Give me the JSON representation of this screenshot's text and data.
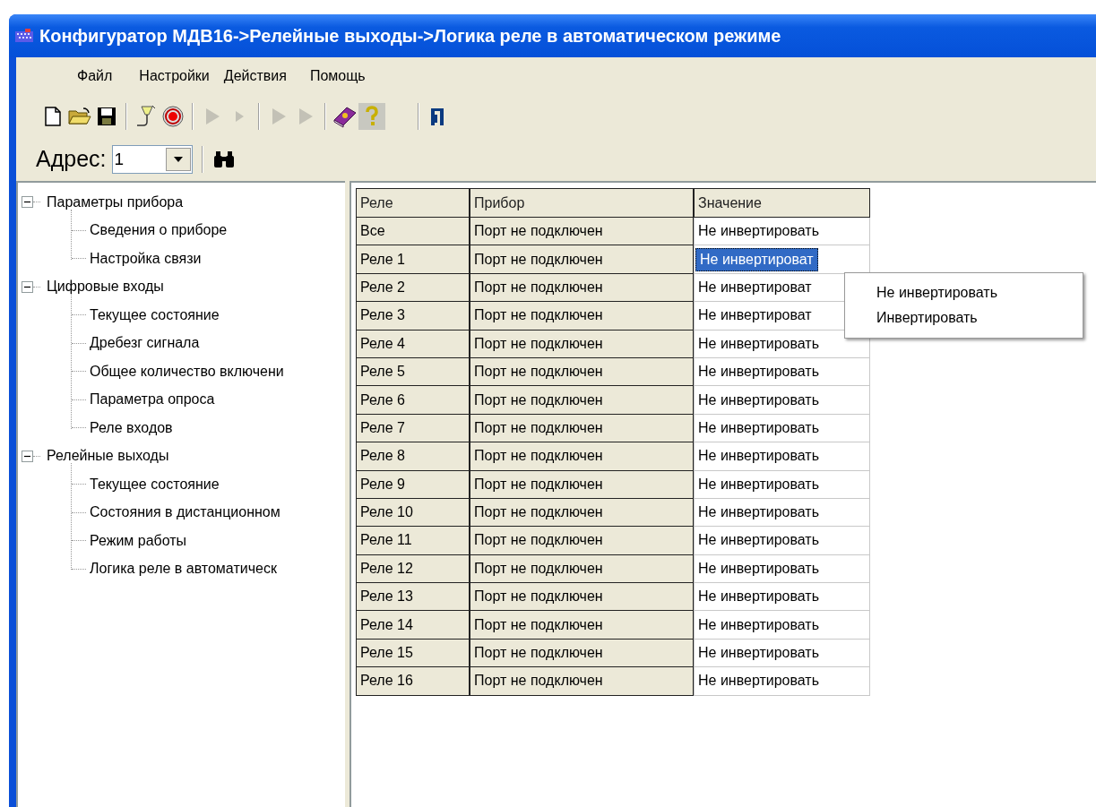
{
  "window": {
    "title": "Конфигуратор МДВ16->Релейные выходы->Логика реле в автоматическом режиме"
  },
  "menu": [
    "Файл",
    "Настройки",
    "Действия",
    "Помощь"
  ],
  "toolbar": [
    {
      "kind": "new",
      "disabled": false
    },
    {
      "kind": "open",
      "disabled": false
    },
    {
      "kind": "save",
      "disabled": false
    },
    {
      "kind": "separator"
    },
    {
      "kind": "probe",
      "disabled": false
    },
    {
      "kind": "record",
      "disabled": false
    },
    {
      "kind": "separator"
    },
    {
      "kind": "play",
      "disabled": true
    },
    {
      "kind": "play-small",
      "disabled": true
    },
    {
      "kind": "separator"
    },
    {
      "kind": "play",
      "disabled": true
    },
    {
      "kind": "play",
      "disabled": true
    },
    {
      "kind": "separator"
    },
    {
      "kind": "book",
      "disabled": false
    },
    {
      "kind": "help",
      "disabled": false
    },
    {
      "kind": "gap"
    },
    {
      "kind": "separator"
    },
    {
      "kind": "exit",
      "disabled": false
    }
  ],
  "address": {
    "label": "Адрес:",
    "value": "1"
  },
  "tree": [
    {
      "label": "Параметры прибора",
      "expanded": true,
      "children": [
        {
          "label": "Сведения о приборе"
        },
        {
          "label": "Настройка связи"
        }
      ]
    },
    {
      "label": "Цифровые входы",
      "expanded": true,
      "children": [
        {
          "label": "Текущее состояние"
        },
        {
          "label": "Дребезг сигнала"
        },
        {
          "label": "Общее количество включени"
        },
        {
          "label": "Параметра опроса"
        },
        {
          "label": "Реле входов"
        }
      ]
    },
    {
      "label": "Релейные выходы",
      "expanded": true,
      "children": [
        {
          "label": "Текущее состояние"
        },
        {
          "label": "Состояния в дистанционном"
        },
        {
          "label": "Режим работы"
        },
        {
          "label": "Логика реле в автоматическ"
        }
      ]
    }
  ],
  "table": {
    "columns": [
      "Реле",
      "Прибор",
      "Значение"
    ],
    "rows": [
      {
        "cells": [
          "Все",
          "Порт не подключен",
          "Не инвертировать"
        ],
        "selected": false
      },
      {
        "cells": [
          "Реле 1",
          "Порт не подключен",
          "Не инвертироват"
        ],
        "selected": true
      },
      {
        "cells": [
          "Реле 2",
          "Порт не подключен",
          "Не инвертироват"
        ],
        "selected": false
      },
      {
        "cells": [
          "Реле 3",
          "Порт не подключен",
          "Не инвертироват"
        ],
        "selected": false
      },
      {
        "cells": [
          "Реле 4",
          "Порт не подключен",
          "Не инвертировать"
        ],
        "selected": false
      },
      {
        "cells": [
          "Реле 5",
          "Порт не подключен",
          "Не инвертировать"
        ],
        "selected": false
      },
      {
        "cells": [
          "Реле 6",
          "Порт не подключен",
          "Не инвертировать"
        ],
        "selected": false
      },
      {
        "cells": [
          "Реле 7",
          "Порт не подключен",
          "Не инвертировать"
        ],
        "selected": false
      },
      {
        "cells": [
          "Реле 8",
          "Порт не подключен",
          "Не инвертировать"
        ],
        "selected": false
      },
      {
        "cells": [
          "Реле 9",
          "Порт не подключен",
          "Не инвертировать"
        ],
        "selected": false
      },
      {
        "cells": [
          "Реле 10",
          "Порт не подключен",
          "Не инвертировать"
        ],
        "selected": false
      },
      {
        "cells": [
          "Реле 11",
          "Порт не подключен",
          "Не инвертировать"
        ],
        "selected": false
      },
      {
        "cells": [
          "Реле 12",
          "Порт не подключен",
          "Не инвертировать"
        ],
        "selected": false
      },
      {
        "cells": [
          "Реле 13",
          "Порт не подключен",
          "Не инвертировать"
        ],
        "selected": false
      },
      {
        "cells": [
          "Реле 14",
          "Порт не подключен",
          "Не инвертировать"
        ],
        "selected": false
      },
      {
        "cells": [
          "Реле 15",
          "Порт не подключен",
          "Не инвертировать"
        ],
        "selected": false
      },
      {
        "cells": [
          "Реле 16",
          "Порт не подключен",
          "Не инвертировать"
        ],
        "selected": false
      }
    ]
  },
  "dropdown": {
    "options": [
      {
        "label": "Не инвертировать",
        "selected": false
      },
      {
        "label": "Инвертировать",
        "selected": false
      }
    ]
  }
}
